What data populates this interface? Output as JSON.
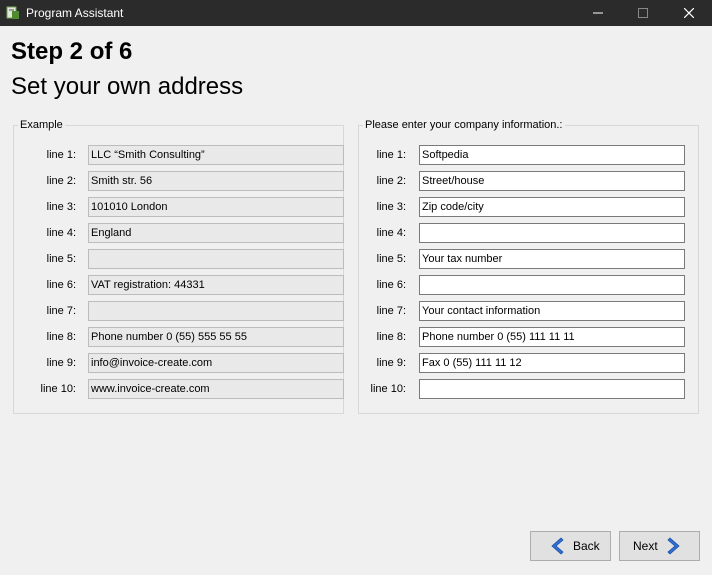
{
  "window": {
    "title": "Program Assistant",
    "controls": {
      "minimize": "—",
      "maximize": "☐",
      "close": "✕"
    }
  },
  "header": {
    "step": "Step 2 of 6",
    "subtitle": "Set your own address"
  },
  "example": {
    "legend": "Example",
    "lines": [
      {
        "label": "line 1:",
        "value": "LLC “Smith Consulting”"
      },
      {
        "label": "line 2:",
        "value": "Smith str. 56"
      },
      {
        "label": "line 3:",
        "value": "101010 London"
      },
      {
        "label": "line 4:",
        "value": "England"
      },
      {
        "label": "line 5:",
        "value": ""
      },
      {
        "label": "line 6:",
        "value": "VAT registration: 44331"
      },
      {
        "label": "line 7:",
        "value": ""
      },
      {
        "label": "line 8:",
        "value": "Phone number 0 (55) 555 55 55"
      },
      {
        "label": "line 9:",
        "value": "info@invoice-create.com"
      },
      {
        "label": "line 10:",
        "value": "www.invoice-create.com"
      }
    ]
  },
  "company": {
    "legend": "Please enter your company information.:",
    "lines": [
      {
        "label": "line 1:",
        "value": "Softpedia"
      },
      {
        "label": "line 2:",
        "value": "Street/house"
      },
      {
        "label": "line 3:",
        "value": "Zip code/city"
      },
      {
        "label": "line 4:",
        "value": ""
      },
      {
        "label": "line 5:",
        "value": "Your tax number"
      },
      {
        "label": "line 6:",
        "value": ""
      },
      {
        "label": "line 7:",
        "value": "Your contact information"
      },
      {
        "label": "line 8:",
        "value": "Phone number 0 (55) 111 11 11"
      },
      {
        "label": "line 9:",
        "value": "Fax 0 (55) 111 11 12"
      },
      {
        "label": "line 10:",
        "value": ""
      }
    ]
  },
  "buttons": {
    "back": "Back",
    "next": "Next"
  },
  "colors": {
    "titlebar": "#2b2b2b",
    "window_bg": "#f0f0f0",
    "arrow_blue": "#2f6fd6"
  }
}
